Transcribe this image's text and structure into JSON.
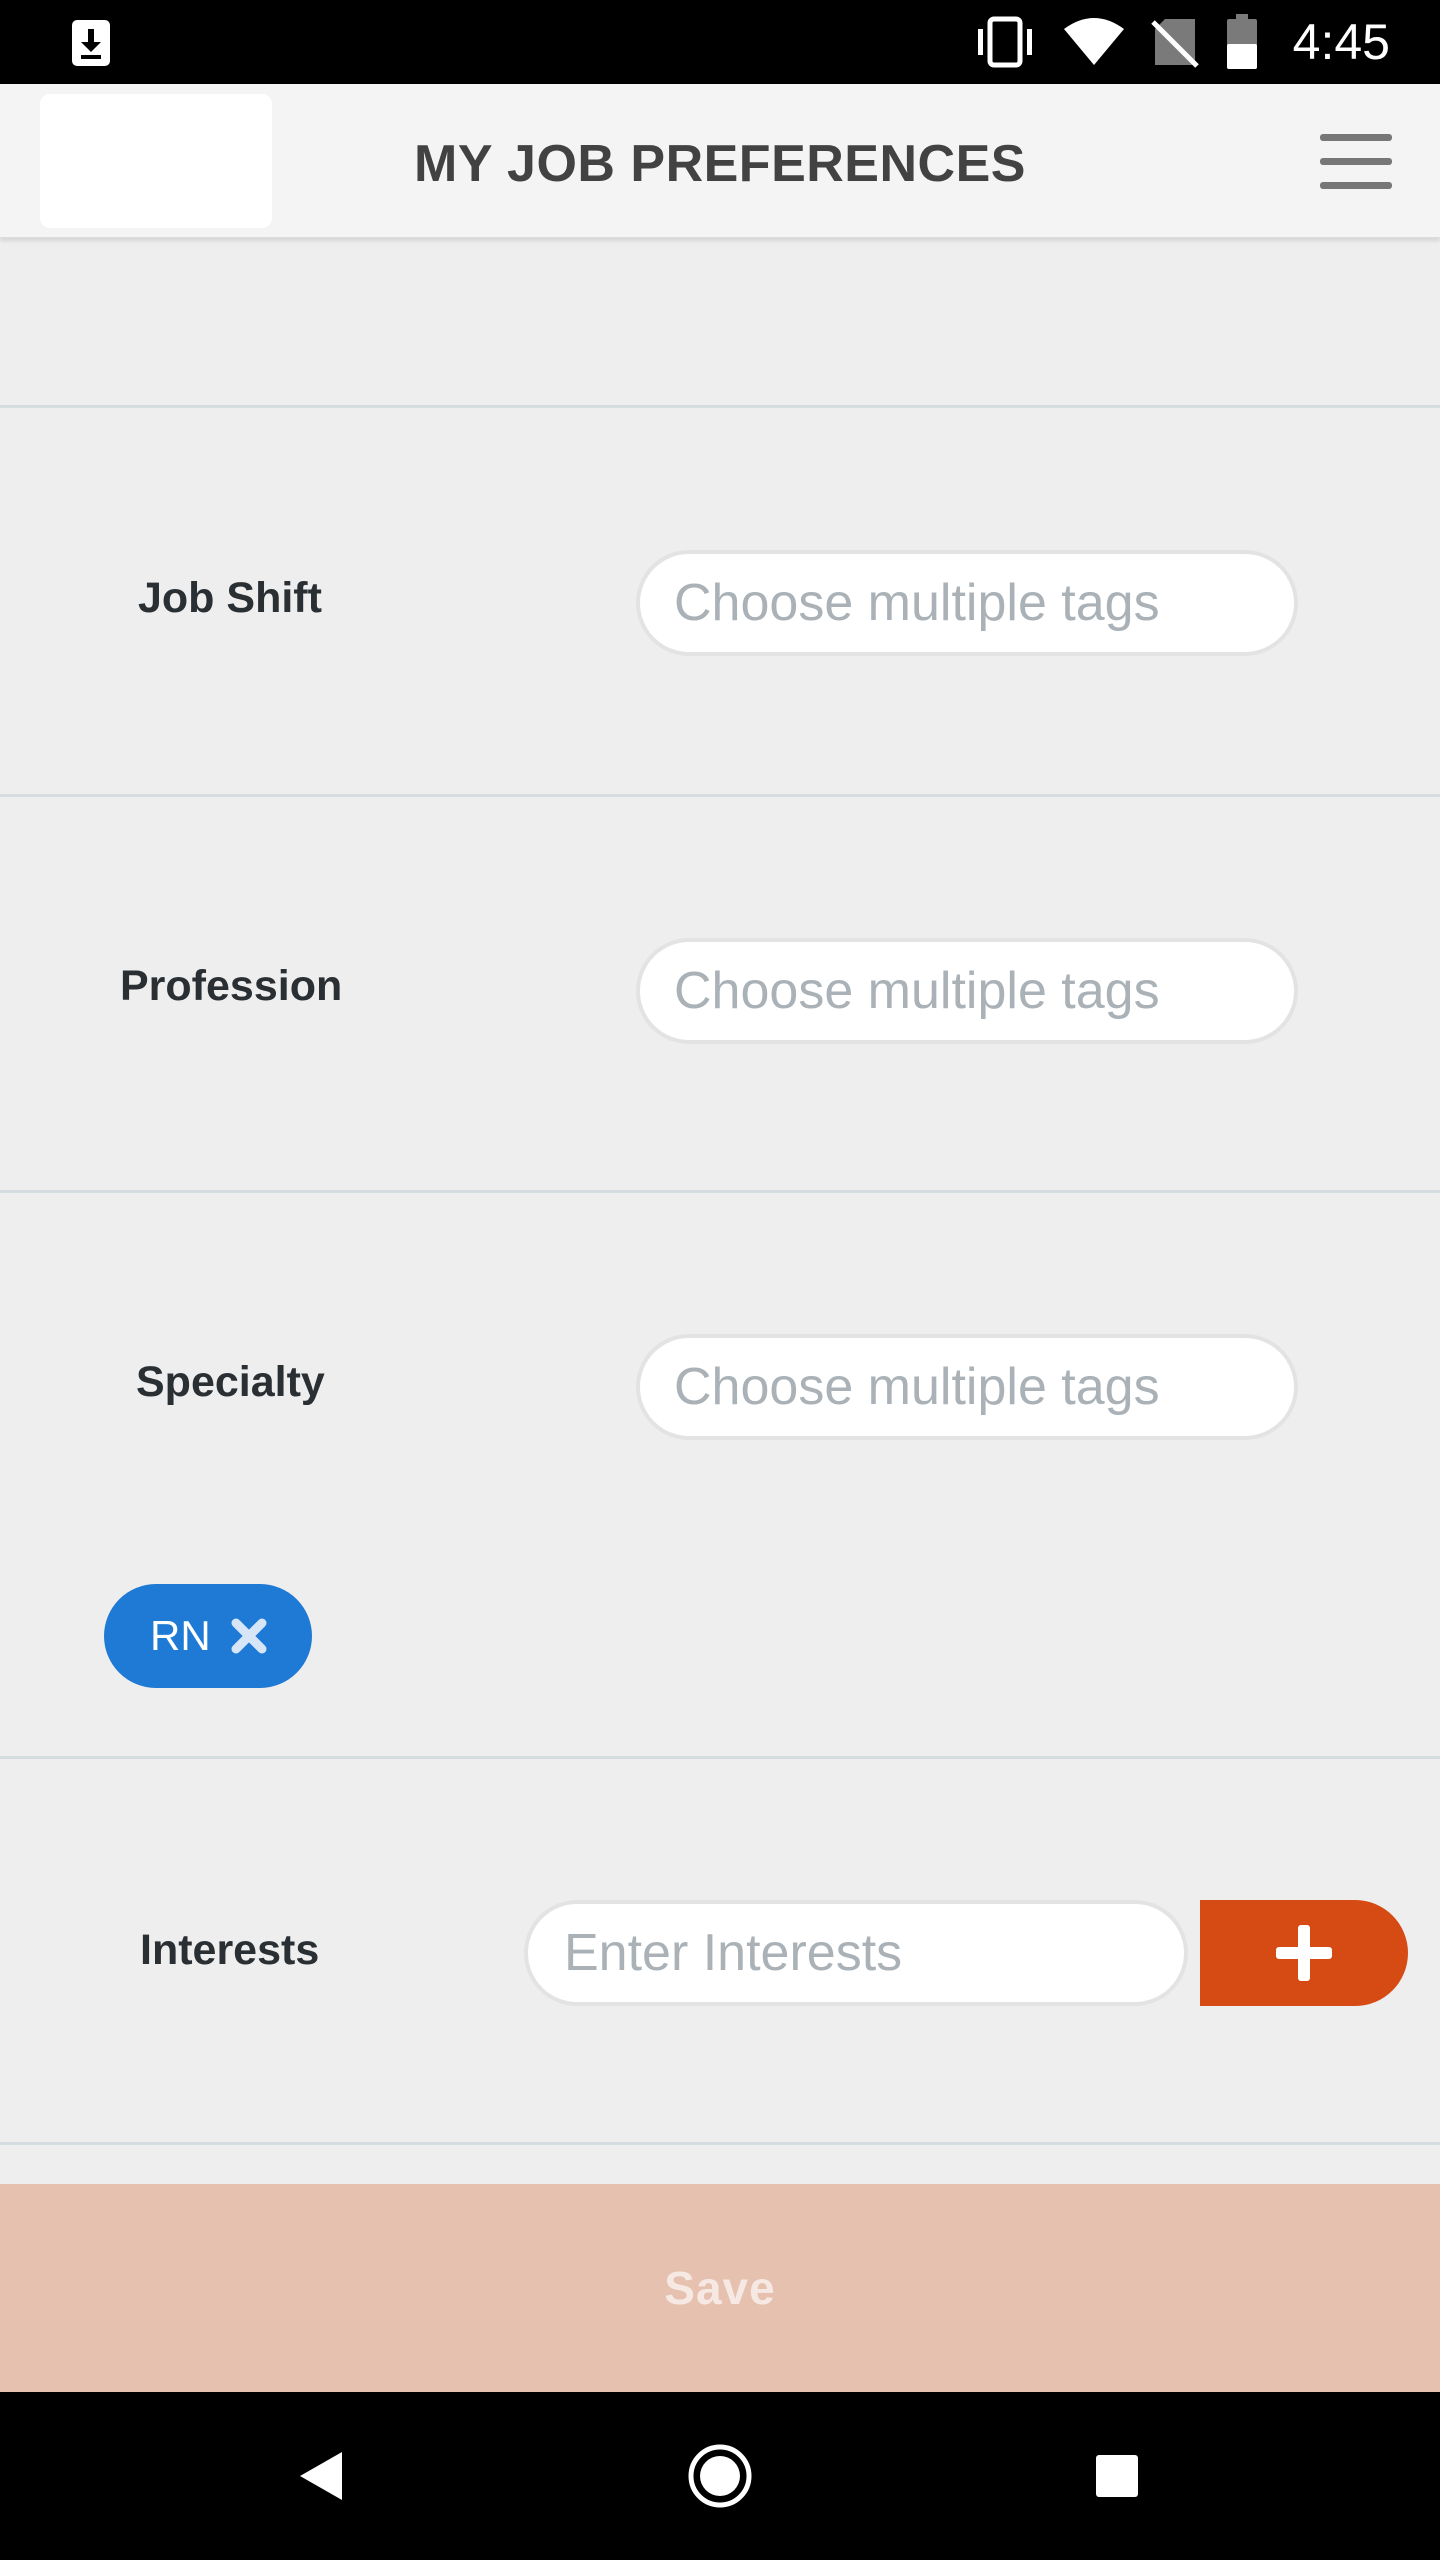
{
  "status_bar": {
    "time": "4:45",
    "icons": [
      "download-icon",
      "vibrate-icon",
      "wifi-icon",
      "no-sim-icon",
      "battery-icon"
    ]
  },
  "header": {
    "title": "MY JOB PREFERENCES",
    "menu_icon": "hamburger-menu-icon"
  },
  "form": {
    "job_shift": {
      "label": "Job Shift",
      "placeholder": "Choose multiple tags"
    },
    "profession": {
      "label": "Profession",
      "placeholder": "Choose multiple tags"
    },
    "specialty": {
      "label": "Specialty",
      "placeholder": "Choose multiple tags",
      "selected_tags": [
        {
          "label": "RN",
          "remove_icon": "close-icon"
        }
      ]
    },
    "interests": {
      "label": "Interests",
      "placeholder": "Enter Interests",
      "add_icon": "plus-icon"
    }
  },
  "save_label": "Save",
  "colors": {
    "accent": "#d64a14",
    "chip": "#1f7ad6",
    "save_disabled_bg": "#e6c1b0",
    "background": "#eeeeee"
  },
  "nav_bar": {
    "icons": [
      "back-icon",
      "home-icon",
      "recents-icon"
    ]
  }
}
